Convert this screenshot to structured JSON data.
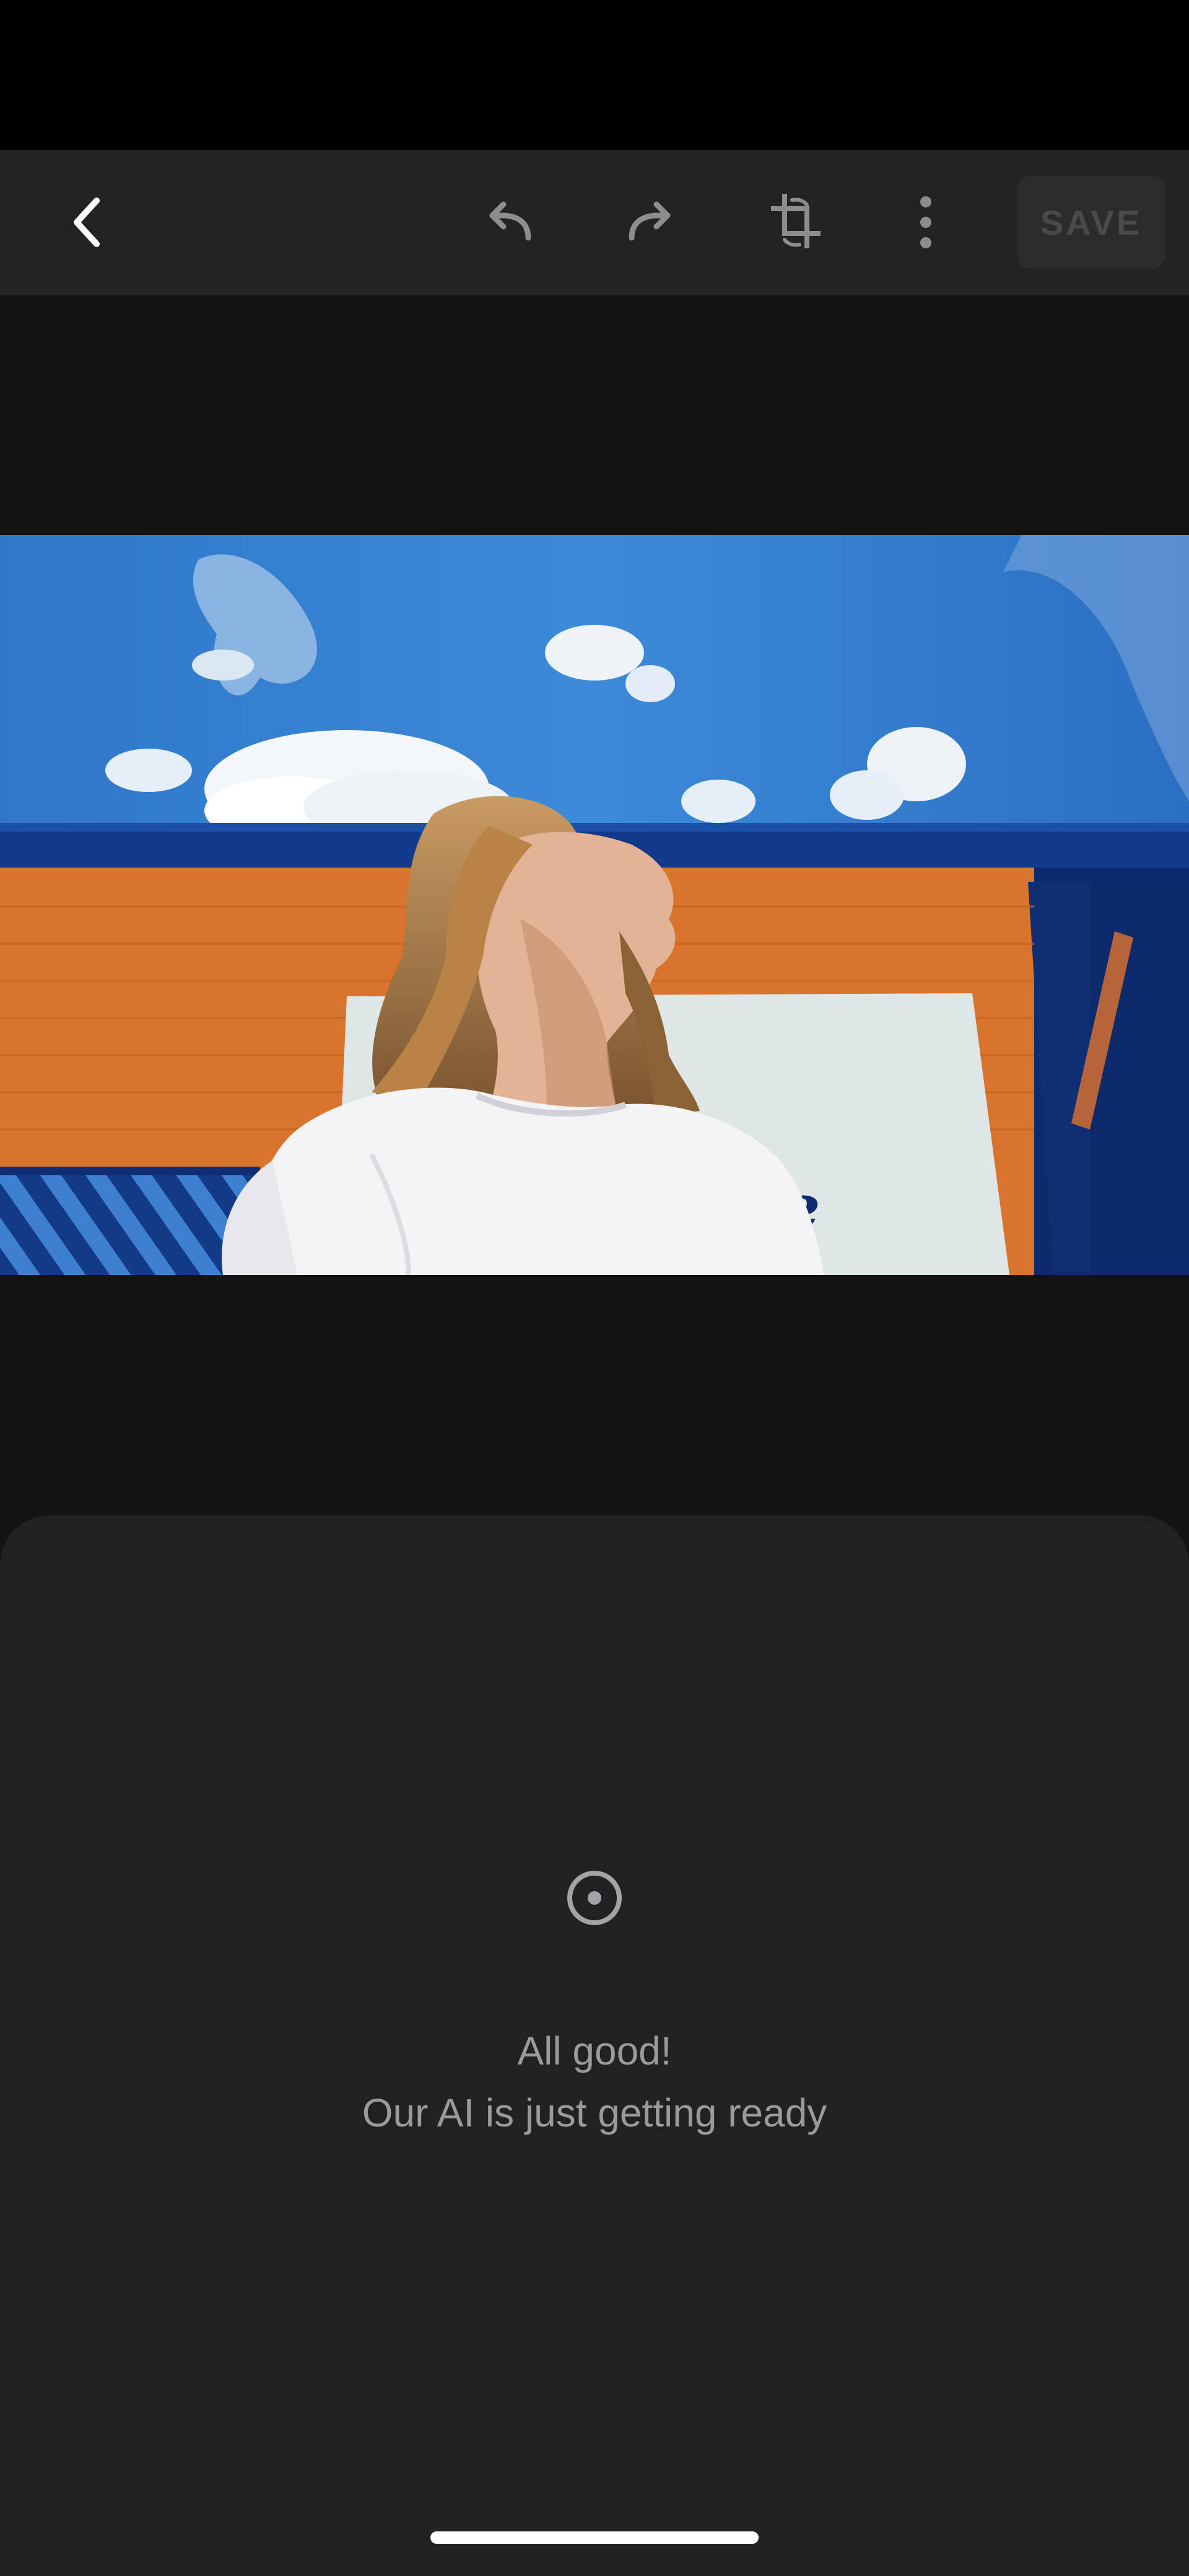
{
  "toolbar": {
    "save_label": "SAVE",
    "icons": [
      "chevron-left-icon",
      "undo-icon",
      "redo-icon",
      "crop-rotate-icon",
      "more-vert-icon"
    ],
    "save_enabled": false
  },
  "loading": {
    "title": "All good!",
    "subtitle": "Our AI is just getting ready",
    "icon": "radio-target-icon"
  },
  "colors": {
    "toolbar_bg": "#232325",
    "sheet_bg": "#212123",
    "canvas_bg": "#131313",
    "text_muted": "#9a9a9e",
    "save_disabled_text": "#4a4a4c"
  }
}
